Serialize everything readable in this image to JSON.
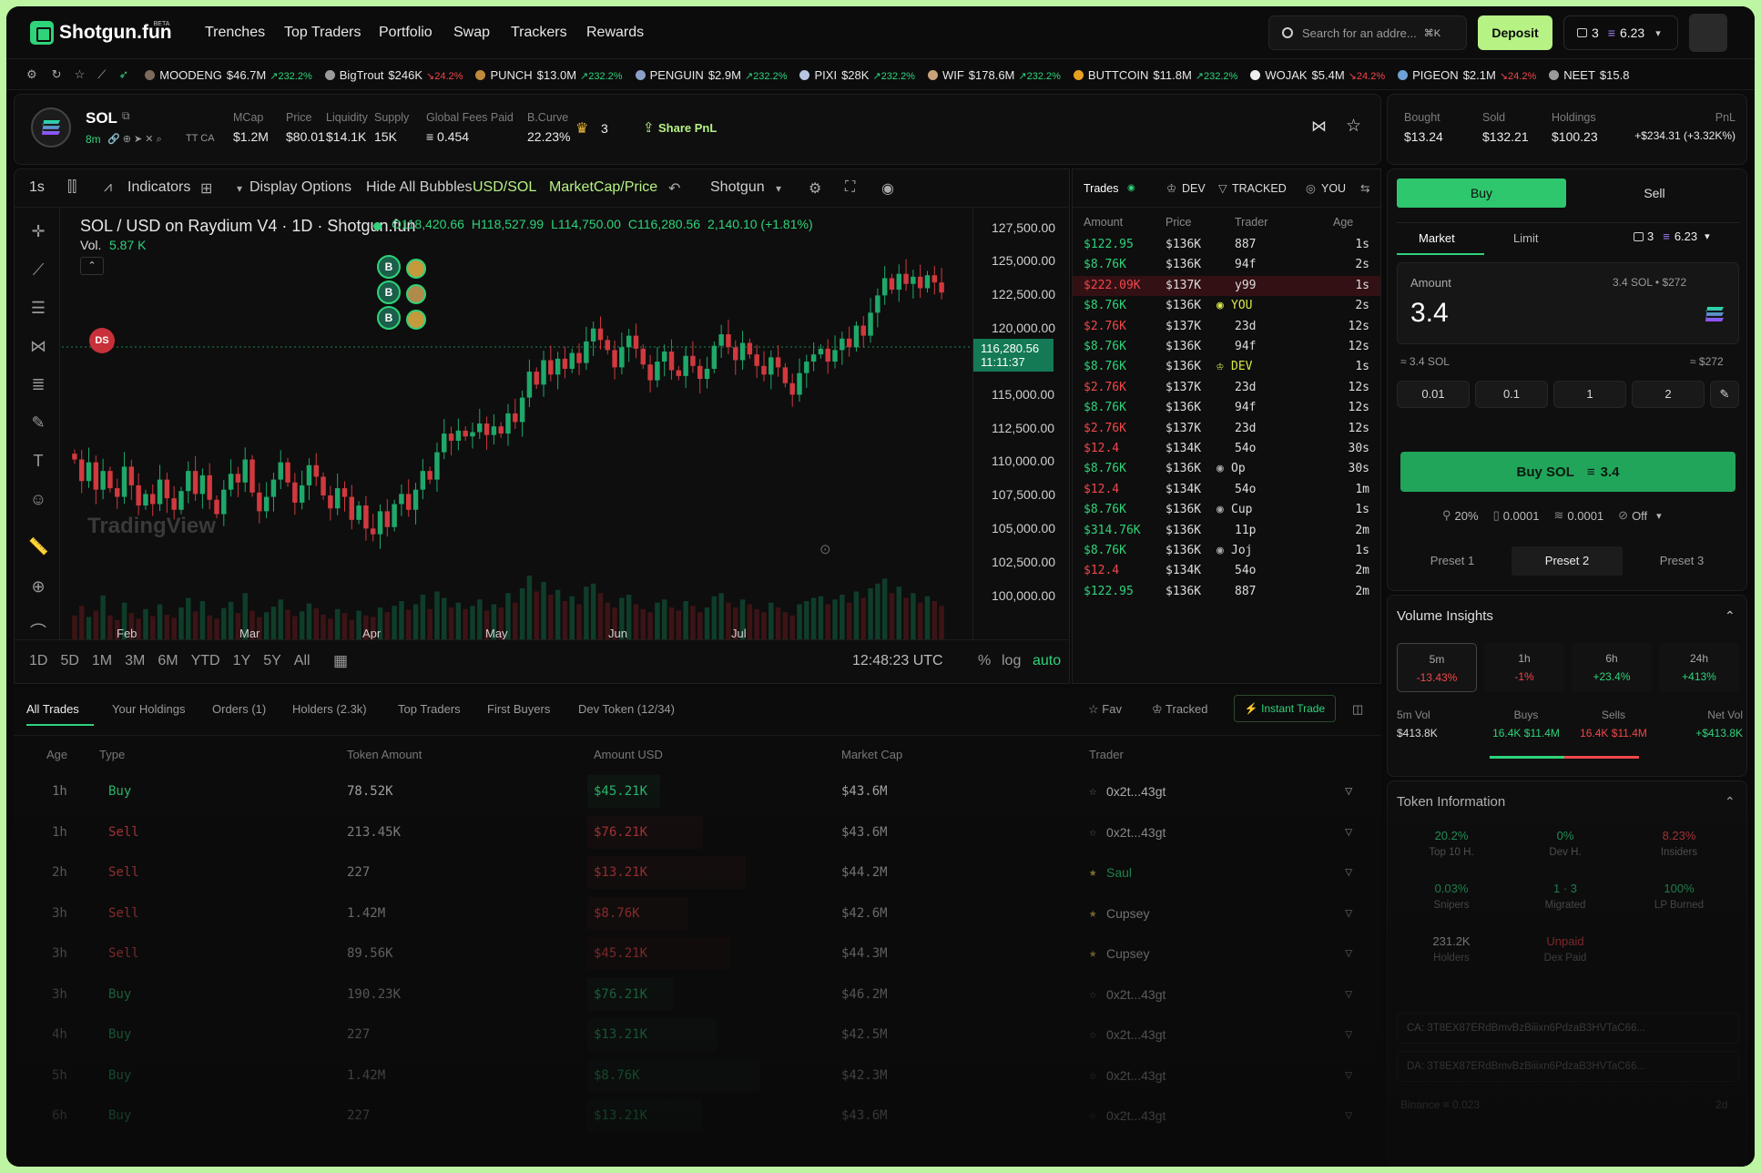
{
  "nav": {
    "brand": "Shotgun.fun",
    "beta": "BETA",
    "links": [
      "Trenches",
      "Top Traders",
      "Portfolio",
      "Swap",
      "Trackers",
      "Rewards"
    ],
    "search_placeholder": "Search for an addre...",
    "search_shortcut": "⌘K",
    "deposit_label": "Deposit",
    "wallet_count": "3",
    "wallet_balance": "6.23"
  },
  "ticker": [
    {
      "name": "MOODENG",
      "value": "$46.7M",
      "change": "↗232.2%",
      "up": true,
      "color": "#7c6a5a"
    },
    {
      "name": "BigTrout",
      "value": "$246K",
      "change": "↘24.2%",
      "up": false,
      "color": "#9a9a9a"
    },
    {
      "name": "PUNCH",
      "value": "$13.0M",
      "change": "↗232.2%",
      "up": true,
      "color": "#c08a3a"
    },
    {
      "name": "PENGUIN",
      "value": "$2.9M",
      "change": "↗232.2%",
      "up": true,
      "color": "#8aa0c8"
    },
    {
      "name": "PIXI",
      "value": "$28K",
      "change": "↗232.2%",
      "up": true,
      "color": "#b8c4e0"
    },
    {
      "name": "WIF",
      "value": "$178.6M",
      "change": "↗232.2%",
      "up": true,
      "color": "#c9a27a"
    },
    {
      "name": "BUTTCOIN",
      "value": "$11.8M",
      "change": "↗232.2%",
      "up": true,
      "color": "#e8a020"
    },
    {
      "name": "WOJAK",
      "value": "$5.4M",
      "change": "↘24.2%",
      "up": false,
      "color": "#eeeeee"
    },
    {
      "name": "PIGEON",
      "value": "$2.1M",
      "change": "↘24.2%",
      "up": false,
      "color": "#6fa0d8"
    },
    {
      "name": "NEET",
      "value": "$15.8",
      "change": "",
      "up": true,
      "color": "#9a9a9a"
    }
  ],
  "token": {
    "symbol": "SOL",
    "age": "8m",
    "links": "TT  CA",
    "stats": [
      {
        "label": "MCap",
        "value": "$1.2M"
      },
      {
        "label": "Price",
        "value": "$80.01"
      },
      {
        "label": "Liquidity",
        "value": "$14.1K"
      },
      {
        "label": "Supply",
        "value": "15K"
      },
      {
        "label": "Global Fees Paid",
        "value": "≡ 0.454"
      },
      {
        "label": "B.Curve",
        "value": "22.23%"
      }
    ],
    "crown_count": "3",
    "share_label": "Share PnL"
  },
  "pnl": [
    {
      "label": "Bought",
      "value": "$13.24",
      "color": "green"
    },
    {
      "label": "Sold",
      "value": "$132.21",
      "color": "red"
    },
    {
      "label": "Holdings",
      "value": "$100.23",
      "color": "white"
    },
    {
      "label": "PnL",
      "value": "+$234.31 (+3.32K%)",
      "color": "green"
    }
  ],
  "chart_toolbar": {
    "interval": "1s",
    "indicators": "Indicators",
    "display_options": "Display Options",
    "hide_bubbles": "Hide All Bubbles",
    "usd_sol": "USD/SOL",
    "mcap_price": "MarketCap/Price",
    "source": "Shotgun"
  },
  "chart_data": {
    "type": "candlestick",
    "title": "SOL / USD on Raydium V4 · 1D · Shotgun.fun",
    "ohlc": {
      "o": "O118,420.66",
      "h": "H118,527.99",
      "l": "L114,750.00",
      "c": "C116,280.56",
      "chg": "2,140.10 (+1.81%)"
    },
    "volume_label": "Vol.",
    "volume_value": "5.87 K",
    "ylim": [
      98500,
      128500
    ],
    "y_ticks": [
      "127,500.00",
      "125,000.00",
      "122,500.00",
      "120,000.00",
      "115,000.00",
      "112,500.00",
      "110,000.00",
      "107,500.00",
      "105,000.00",
      "102,500.00",
      "100,000.00"
    ],
    "x_ticks": [
      "Feb",
      "Mar",
      "Apr",
      "May",
      "Jun",
      "Jul"
    ],
    "last_price": "116,280.56",
    "countdown": "11:11:37",
    "marker": "DS",
    "bubbles": [
      "B",
      "B",
      "B"
    ],
    "watermark": "TradingView",
    "closes": [
      111000,
      109500,
      110800,
      108900,
      110200,
      109000,
      108400,
      110500,
      109200,
      107800,
      108600,
      107900,
      109600,
      108300,
      107500,
      108800,
      110200,
      108600,
      109900,
      108200,
      107200,
      108900,
      110000,
      109400,
      111000,
      108700,
      107400,
      108400,
      109600,
      110800,
      109400,
      108000,
      109200,
      110600,
      109800,
      108500,
      107600,
      109000,
      108400,
      106800,
      107800,
      106200,
      105800,
      107400,
      106300,
      107900,
      108600,
      107500,
      108900,
      110200,
      109600,
      111500,
      112800,
      112300,
      113000,
      112600,
      112900,
      113500,
      112700,
      113300,
      112800,
      114200,
      113600,
      115300,
      117100,
      116200,
      117900,
      116900,
      118000,
      117300,
      118400,
      117700,
      119200,
      120100,
      119300,
      118600,
      117400,
      118800,
      119600,
      118700,
      117600,
      116500,
      117800,
      118500,
      117200,
      116800,
      118200,
      117500,
      116600,
      117300,
      118900,
      119700,
      118800,
      117900,
      119100,
      118300,
      117500,
      116900,
      118100,
      117400,
      116300,
      115500,
      117000,
      117800,
      118300,
      118700,
      117800,
      118600,
      119400,
      118800,
      120300,
      119600,
      121200,
      122400,
      123600,
      122800,
      123900,
      123200,
      123700,
      122900,
      123800,
      123300,
      122600
    ],
    "volumes": [
      30,
      42,
      28,
      36,
      55,
      30,
      24,
      46,
      33,
      26,
      38,
      29,
      44,
      31,
      27,
      40,
      52,
      35,
      48,
      30,
      26,
      39,
      47,
      33,
      58,
      36,
      28,
      34,
      41,
      50,
      37,
      29,
      35,
      45,
      39,
      31,
      26,
      38,
      33,
      24,
      36,
      30,
      28,
      40,
      34,
      42,
      48,
      37,
      44,
      56,
      38,
      60,
      52,
      40,
      46,
      38,
      42,
      50,
      36,
      44,
      40,
      58,
      46,
      64,
      80,
      60,
      72,
      56,
      62,
      48,
      54,
      44,
      66,
      70,
      58,
      46,
      40,
      52,
      56,
      44,
      38,
      34,
      46,
      50,
      40,
      36,
      48,
      42,
      34,
      40,
      54,
      58,
      46,
      40,
      50,
      44,
      38,
      34,
      46,
      40,
      34,
      30,
      44,
      48,
      52,
      54,
      44,
      50,
      56,
      46,
      60,
      52,
      64,
      70,
      76,
      58,
      66,
      52,
      58,
      46,
      54,
      48,
      42
    ]
  },
  "range_bar": {
    "ranges": [
      "1D",
      "5D",
      "1M",
      "3M",
      "6M",
      "YTD",
      "1Y",
      "5Y",
      "All"
    ],
    "time": "12:48:23 UTC",
    "pct": "%",
    "log": "log",
    "auto": "auto"
  },
  "trades": {
    "tabs": [
      "Trades",
      "DEV",
      "TRACKED",
      "YOU"
    ],
    "headers": [
      "Amount",
      "Price",
      "Trader",
      "Age"
    ],
    "rows": [
      {
        "amount": "$122.95",
        "price": "$136K",
        "trader": "887",
        "age": "1s",
        "side": "buy",
        "tag": ""
      },
      {
        "amount": "$8.76K",
        "price": "$136K",
        "trader": "94f",
        "age": "2s",
        "side": "buy",
        "tag": ""
      },
      {
        "amount": "$222.09K",
        "price": "$137K",
        "trader": "y99",
        "age": "1s",
        "side": "sell",
        "tag": ""
      },
      {
        "amount": "$8.76K",
        "price": "$136K",
        "trader": "YOU",
        "age": "2s",
        "side": "buy",
        "tag": "you"
      },
      {
        "amount": "$2.76K",
        "price": "$137K",
        "trader": "23d",
        "age": "12s",
        "side": "sell",
        "tag": ""
      },
      {
        "amount": "$8.76K",
        "price": "$136K",
        "trader": "94f",
        "age": "12s",
        "side": "buy",
        "tag": ""
      },
      {
        "amount": "$8.76K",
        "price": "$136K",
        "trader": "DEV",
        "age": "1s",
        "side": "buy",
        "tag": "dev"
      },
      {
        "amount": "$2.76K",
        "price": "$137K",
        "trader": "23d",
        "age": "12s",
        "side": "sell",
        "tag": ""
      },
      {
        "amount": "$8.76K",
        "price": "$136K",
        "trader": "94f",
        "age": "12s",
        "side": "buy",
        "tag": ""
      },
      {
        "amount": "$2.76K",
        "price": "$137K",
        "trader": "23d",
        "age": "12s",
        "side": "sell",
        "tag": ""
      },
      {
        "amount": "$12.4",
        "price": "$134K",
        "trader": "54o",
        "age": "30s",
        "side": "sell",
        "tag": ""
      },
      {
        "amount": "$8.76K",
        "price": "$136K",
        "trader": "Op",
        "age": "30s",
        "side": "buy",
        "tag": "op"
      },
      {
        "amount": "$12.4",
        "price": "$134K",
        "trader": "54o",
        "age": "1m",
        "side": "sell",
        "tag": ""
      },
      {
        "amount": "$8.76K",
        "price": "$136K",
        "trader": "Cup",
        "age": "1s",
        "side": "buy",
        "tag": "op"
      },
      {
        "amount": "$314.76K",
        "price": "$136K",
        "trader": "11p",
        "age": "2m",
        "side": "buy",
        "tag": ""
      },
      {
        "amount": "$8.76K",
        "price": "$136K",
        "trader": "Joj",
        "age": "1s",
        "side": "buy",
        "tag": "joj"
      },
      {
        "amount": "$12.4",
        "price": "$134K",
        "trader": "54o",
        "age": "2m",
        "side": "sell",
        "tag": ""
      },
      {
        "amount": "$122.95",
        "price": "$136K",
        "trader": "887",
        "age": "2m",
        "side": "buy",
        "tag": ""
      }
    ]
  },
  "trade_panel": {
    "buy": "Buy",
    "sell": "Sell",
    "market": "Market",
    "limit": "Limit",
    "wallets": "3",
    "balance": "6.23",
    "amount_label": "Amount",
    "amount_info": "3.4 SOL • $272",
    "amount_value": "3.4",
    "sol_amount": "≈ 3.4 SOL",
    "usd_amount": "≈ $272",
    "presets": [
      "0.01",
      "0.1",
      "1",
      "2"
    ],
    "buy_button": "Buy SOL",
    "buy_amount": "3.4",
    "settings": [
      "20%",
      "0.0001",
      "0.0001",
      "Off"
    ],
    "preset_tabs": [
      "Preset 1",
      "Preset 2",
      "Preset 3"
    ]
  },
  "volume_insights": {
    "title": "Volume Insights",
    "periods": [
      {
        "label": "5m",
        "change": "-13.43%",
        "up": false
      },
      {
        "label": "1h",
        "change": "-1%",
        "up": false
      },
      {
        "label": "6h",
        "change": "+23.4%",
        "up": true
      },
      {
        "label": "24h",
        "change": "+413%",
        "up": true
      }
    ],
    "cols": [
      {
        "label": "5m Vol",
        "value": "$413.8K"
      },
      {
        "label": "Buys",
        "value": "16.4K  $11.4M"
      },
      {
        "label": "Sells",
        "value": "16.4K  $11.4M"
      },
      {
        "label": "Net Vol",
        "value": "+$413.8K"
      }
    ]
  },
  "token_info": {
    "title": "Token Information",
    "cells": [
      {
        "value": "20.2%",
        "label": "Top 10 H.",
        "color": "green"
      },
      {
        "value": "0%",
        "label": "Dev H.",
        "color": "green"
      },
      {
        "value": "8.23%",
        "label": "Insiders",
        "color": "red"
      },
      {
        "value": "0.03%",
        "label": "Snipers",
        "color": "green"
      },
      {
        "value": "1 · 3",
        "label": "Migrated",
        "color": "green"
      },
      {
        "value": "100%",
        "label": "LP Burned",
        "color": "green"
      },
      {
        "value": "231.2K",
        "label": "Holders",
        "color": "white"
      },
      {
        "value": "Unpaid",
        "label": "Dex Paid",
        "color": "red"
      }
    ],
    "ca": "CA: 3T8EX87ERdBmvBzBiiixn6PdzaB3HVTaC66...",
    "da": "DA: 3T8EX87ERdBmvBzBiiixn6PdzaB3HVTaC66...",
    "footer": "Binance  ≡ 0.023",
    "footer_age": "2d"
  },
  "bottom": {
    "tabs": [
      "All Trades",
      "Your Holdings",
      "Orders (1)",
      "Holders (2.3k)",
      "Top Traders",
      "First Buyers",
      "Dev Token (12/34)"
    ],
    "fav": "Fav",
    "tracked": "Tracked",
    "instant": "Instant Trade",
    "headers": [
      "Age",
      "Type",
      "Token Amount",
      "Amount USD",
      "Market Cap",
      "Trader"
    ],
    "rows": [
      {
        "age": "1h",
        "type": "Buy",
        "tokens": "78.52K",
        "usd": "$45.21K",
        "mcap": "$43.6M",
        "trader": "0x2t...43gt"
      },
      {
        "age": "1h",
        "type": "Sell",
        "tokens": "213.45K",
        "usd": "$76.21K",
        "mcap": "$43.6M",
        "trader": "0x2t...43gt"
      },
      {
        "age": "2h",
        "type": "Sell",
        "tokens": "227",
        "usd": "$13.21K",
        "mcap": "$44.2M",
        "trader": "Saul"
      },
      {
        "age": "3h",
        "type": "Sell",
        "tokens": "1.42M",
        "usd": "$8.76K",
        "mcap": "$42.6M",
        "trader": "Cupsey"
      },
      {
        "age": "3h",
        "type": "Sell",
        "tokens": "89.56K",
        "usd": "$45.21K",
        "mcap": "$44.3M",
        "trader": "Cupsey"
      },
      {
        "age": "3h",
        "type": "Buy",
        "tokens": "190.23K",
        "usd": "$76.21K",
        "mcap": "$46.2M",
        "trader": "0x2t...43gt"
      },
      {
        "age": "4h",
        "type": "Buy",
        "tokens": "227",
        "usd": "$13.21K",
        "mcap": "$42.5M",
        "trader": "0x2t...43gt"
      },
      {
        "age": "5h",
        "type": "Buy",
        "tokens": "1.42M",
        "usd": "$8.76K",
        "mcap": "$42.3M",
        "trader": "0x2t...43gt"
      },
      {
        "age": "6h",
        "type": "Buy",
        "tokens": "227",
        "usd": "$13.21K",
        "mcap": "$43.6M",
        "trader": "0x2t...43gt"
      }
    ]
  },
  "colors": {
    "green": "#2fd37a",
    "red": "#f0474b",
    "accent": "#b7f285",
    "bg": "#0a0a0a"
  }
}
